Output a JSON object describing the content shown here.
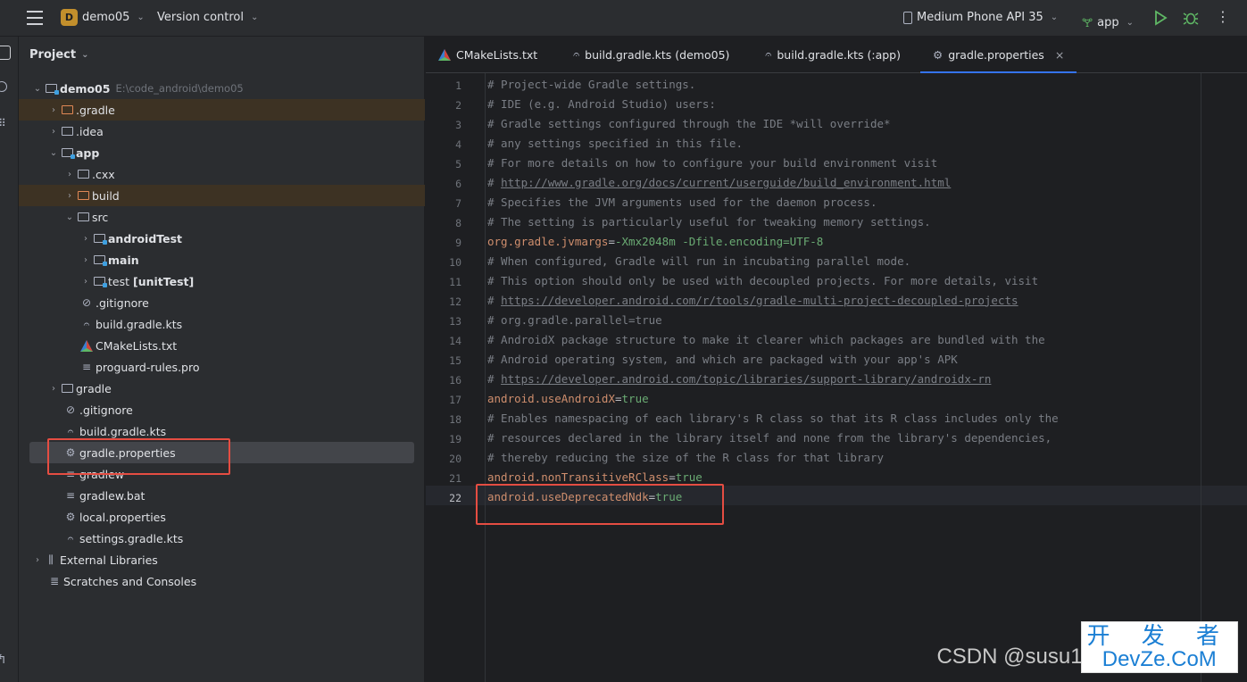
{
  "titlebar": {
    "project_badge": "D",
    "project_name": "demo05",
    "vcs": "Version control",
    "device": "Medium Phone API 35",
    "run_config": "app"
  },
  "project_panel": {
    "title": "Project",
    "tree": [
      {
        "label": "demo05",
        "path": "E:\\code_android\\demo05"
      },
      {
        "label": ".gradle"
      },
      {
        "label": ".idea"
      },
      {
        "label": "app"
      },
      {
        "label": ".cxx"
      },
      {
        "label": "build"
      },
      {
        "label": "src"
      },
      {
        "label": "androidTest"
      },
      {
        "label": "main"
      },
      {
        "label": "test",
        "suffix": "[unitTest]"
      },
      {
        "label": ".gitignore"
      },
      {
        "label": "build.gradle.kts"
      },
      {
        "label": "CMakeLists.txt"
      },
      {
        "label": "proguard-rules.pro"
      },
      {
        "label": "gradle"
      },
      {
        "label": ".gitignore"
      },
      {
        "label": "build.gradle.kts"
      },
      {
        "label": "gradle.properties"
      },
      {
        "label": "gradlew"
      },
      {
        "label": "gradlew.bat"
      },
      {
        "label": "local.properties"
      },
      {
        "label": "settings.gradle.kts"
      },
      {
        "label": "External Libraries"
      },
      {
        "label": "Scratches and Consoles"
      }
    ]
  },
  "editor": {
    "tabs": [
      {
        "label": "CMakeLists.txt"
      },
      {
        "label": "build.gradle.kts (demo05)"
      },
      {
        "label": "build.gradle.kts (:app)"
      },
      {
        "label": "gradle.properties",
        "close": "×"
      }
    ],
    "line_numbers": [
      "1",
      "2",
      "3",
      "4",
      "5",
      "6",
      "7",
      "8",
      "9",
      "10",
      "11",
      "12",
      "13",
      "14",
      "15",
      "16",
      "17",
      "18",
      "19",
      "20",
      "21",
      "22"
    ],
    "lines": [
      {
        "cmt": "# Project-wide Gradle settings."
      },
      {
        "cmt": "# IDE (e.g. Android Studio) users:"
      },
      {
        "cmt": "# Gradle settings configured through the IDE *will override*"
      },
      {
        "cmt": "# any settings specified in this file."
      },
      {
        "cmt": "# For more details on how to configure your build environment visit"
      },
      {
        "cmt": "# ",
        "url": "http://www.gradle.org/docs/current/userguide/build_environment.html"
      },
      {
        "cmt": "# Specifies the JVM arguments used for the daemon process."
      },
      {
        "cmt": "# The setting is particularly useful for tweaking memory settings."
      },
      {
        "key": "org.gradle.jvmargs",
        "eq": "=",
        "val": "-Xmx2048m -Dfile.encoding=UTF-8"
      },
      {
        "cmt": "# When configured, Gradle will run in incubating parallel mode."
      },
      {
        "cmt": "# This option should only be used with decoupled projects. For more details, visit"
      },
      {
        "cmt": "# ",
        "url": "https://developer.android.com/r/tools/gradle-multi-project-decoupled-projects"
      },
      {
        "cmt": "# org.gradle.parallel=true"
      },
      {
        "cmt": "# AndroidX package structure to make it clearer which packages are bundled with the"
      },
      {
        "cmt": "# Android operating system, and which are packaged with your app's APK"
      },
      {
        "cmt": "# ",
        "url": "https://developer.android.com/topic/libraries/support-library/androidx-rn"
      },
      {
        "key": "android.useAndroidX",
        "eq": "=",
        "val": "true"
      },
      {
        "cmt": "# Enables namespacing of each library's R class so that its R class includes only the"
      },
      {
        "cmt": "# resources declared in the library itself and none from the library's dependencies,"
      },
      {
        "cmt": "# thereby reducing the size of the R class for that library"
      },
      {
        "key": "android.nonTransitiveRClass",
        "eq": "=",
        "val": "true"
      },
      {
        "key": "android.useDeprecatedNdk",
        "eq": "=",
        "val": "true"
      }
    ]
  },
  "watermark": {
    "csdn": "CSDN @susu1",
    "brand_top": "开 发 者",
    "brand_bottom": "DevZe.CoM"
  }
}
